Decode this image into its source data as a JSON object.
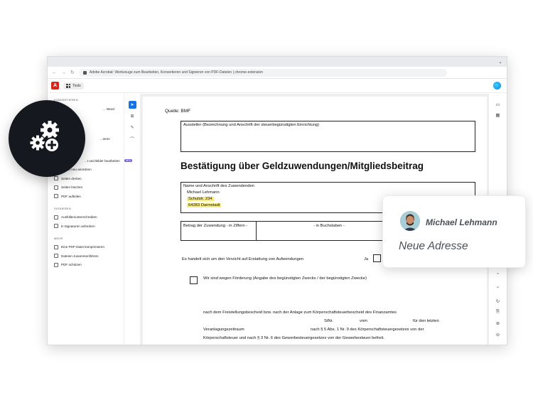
{
  "browser": {
    "tab_title": "Adobe Acrobat: Werkzeuge zum Bearbeiten, Konvertieren und Signieren von PDF-Dateien | chrome-extension",
    "menu_dots": "⌄"
  },
  "toolbar": {
    "logo_letter": "A",
    "tools_label": "Tools"
  },
  "left_panel": {
    "sections": {
      "convert": "KONVERTIEREN",
      "sign": "SIGNIEREN",
      "more": "MEHR"
    },
    "convert_items": [
      "… Word",
      "…ieren"
    ],
    "edit_items": [
      "…t und Bilder bearbeiten",
      "Seiten neu anordnen",
      "Seiten drehen",
      "Seiten löschen",
      "PDF aufteilen"
    ],
    "new_badge": "NEU",
    "sign_items": [
      "Ausfüllen/unterschreiben",
      "E-Signaturen anfordern"
    ],
    "more_items": [
      "Eine PDF-Datei komprimieren",
      "Dateien zusammenführen",
      "PDF schützen"
    ]
  },
  "document": {
    "source": "Quelle: BMF",
    "issuer_label": "Aussteller (Bezeichnung und Anschrift der steuerbegünstigten Einrichtung)",
    "heading": "Bestätigung über Geldzuwendungen/Mitgliedsbeitrag",
    "donor_label": "Name und Anschrift des Zuwendenden",
    "donor_name": "Michael Lehmann",
    "donor_street": "Schulstr. 234",
    "donor_city": "64283 Darmstadt",
    "amount_digits_label": "Betrag der Zuwendung - in Ziffern -",
    "amount_words_label": "- in Buchstaben -",
    "waiver_text": "Es handelt sich um den Verzicht auf Erstattung von Aufwendungen",
    "ja_label": "Ja",
    "purpose_text": "Wir sind wegen Förderung (Angabe des begünstigten Zwecks / der begünstigten Zwecke)",
    "para_line1": "nach dem Freistellungsbescheid bzw. nach der Anlage zum Körperschaftsteuerbescheid des Finanzamtes",
    "para_stnr": "StNr.",
    "para_vom": "vom",
    "para_fuer": "für den letzten",
    "para_line3a": "Veranlagungszeitraum",
    "para_line3b": "nach § 5 Abs. 1 Nr. 9 des Körperschaftsteuergesetzes von der",
    "para_line4": "Körperschaftsteuer und nach § 3 Nr. 6 des Gewerbesteuergesetzes von der Gewerbesteuer befreit."
  },
  "note": {
    "user_name": "Michael Lehmann",
    "text": "Neue Adresse"
  },
  "colors": {
    "accent": "#1473e6",
    "highlight": "#f7ec84",
    "badge": "#6f5cdc",
    "overlay": "#15191f"
  }
}
